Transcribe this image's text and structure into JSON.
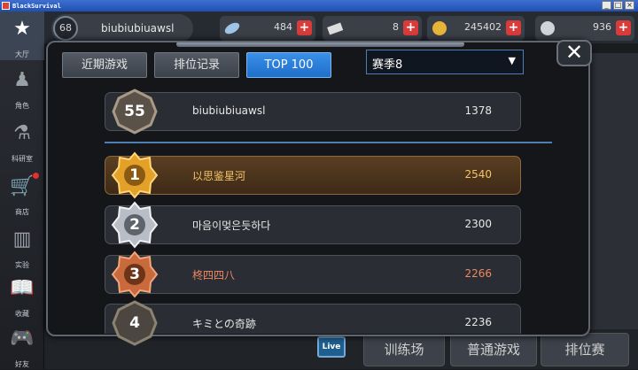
{
  "window": {
    "title": "BlackSurvival",
    "minimize": "_",
    "maximize": "□",
    "close": "×"
  },
  "sidenav": {
    "items": [
      {
        "label": "大厅",
        "icon": "star-icon"
      },
      {
        "label": "角色",
        "icon": "character-icon"
      },
      {
        "label": "科研室",
        "icon": "flask-icon"
      },
      {
        "label": "商店",
        "icon": "cart-icon"
      },
      {
        "label": "实验",
        "icon": "books-icon"
      },
      {
        "label": "收藏",
        "icon": "book-icon"
      },
      {
        "label": "好友",
        "icon": "gamepad-icon"
      }
    ]
  },
  "player": {
    "level": "68",
    "name": "biubiubiuawsl"
  },
  "resources": [
    {
      "icon": "feather-icon",
      "value": "484"
    },
    {
      "icon": "ticket-icon",
      "value": "8"
    },
    {
      "icon": "coin-icon",
      "value": "245402"
    },
    {
      "icon": "bp-icon",
      "value": "936"
    }
  ],
  "bottombar": {
    "live": "Live",
    "buttons": [
      "训练场",
      "普通游戏",
      "排位赛"
    ]
  },
  "modal": {
    "tabs": [
      "近期游戏",
      "排位记录",
      "TOP 100"
    ],
    "active_tab": 2,
    "season": "赛季8",
    "close_label": "✕",
    "me": {
      "rank": "55",
      "name": "biubiubiuawsl",
      "score": "1378"
    },
    "rows": [
      {
        "rank": "1",
        "name": "以思鉴星河",
        "score": "2540",
        "tier": "gold"
      },
      {
        "rank": "2",
        "name": "마음이멎은듯하다",
        "score": "2300",
        "tier": "silver"
      },
      {
        "rank": "3",
        "name": "柊四四八",
        "score": "2266",
        "tier": "bronze"
      },
      {
        "rank": "4",
        "name": "キミとの奇跡",
        "score": "2236",
        "tier": "plain"
      }
    ]
  },
  "colors": {
    "accent": "#1e6fca",
    "gold": "#f3c46a",
    "bronze": "#f08860",
    "silver": "#c8ccd2",
    "plus": "#d93a3a"
  }
}
